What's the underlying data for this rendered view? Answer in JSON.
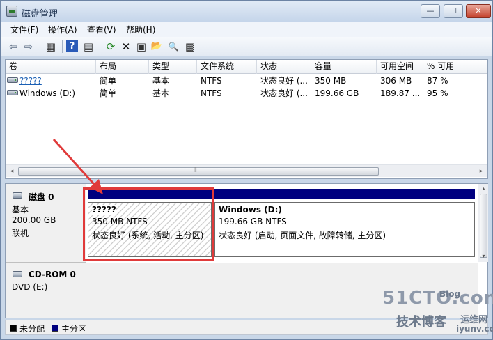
{
  "window": {
    "title": "磁盘管理",
    "min": "—",
    "max": "☐",
    "close": "✕"
  },
  "menu": [
    "文件(F)",
    "操作(A)",
    "查看(V)",
    "帮助(H)"
  ],
  "toolbar": {
    "back": "⇦",
    "forward": "⇨",
    "view": "▦",
    "help": "?",
    "panel": "▤",
    "refresh": "⟳",
    "delete": "✕",
    "properties": "▣",
    "open": "📂",
    "search": "🔍",
    "settings": "▩"
  },
  "columns": [
    "卷",
    "布局",
    "类型",
    "文件系统",
    "状态",
    "容量",
    "可用空间",
    "% 可用"
  ],
  "volumes": [
    {
      "name": "?????",
      "layout": "简单",
      "type": "基本",
      "fs": "NTFS",
      "status": "状态良好 (...",
      "capacity": "350 MB",
      "free": "306 MB",
      "pct": "87 %"
    },
    {
      "name": "Windows (D:)",
      "layout": "简单",
      "type": "基本",
      "fs": "NTFS",
      "status": "状态良好 (...",
      "capacity": "199.66 GB",
      "free": "189.87 ...",
      "pct": "95 %"
    }
  ],
  "scroll": {
    "left": "◂",
    "right": "▸",
    "up": "▴",
    "down": "▾"
  },
  "disk0": {
    "name": "磁盘 0",
    "type": "基本",
    "size": "200.00 GB",
    "state": "联机",
    "partitions": [
      {
        "name": "?????",
        "size": "350 MB NTFS",
        "status": "状态良好 (系统, 活动, 主分区)"
      },
      {
        "name": "Windows  (D:)",
        "size": "199.66 GB NTFS",
        "status": "状态良好 (启动, 页面文件, 故障转储, 主分区)"
      }
    ]
  },
  "cdrom": {
    "name": "CD-ROM 0",
    "type": "DVD (E:)"
  },
  "legend": {
    "unallocated": "未分配",
    "primary": "主分区",
    "unallocated_color": "#000000",
    "primary_color": "#00007f"
  },
  "watermark": {
    "site": "51CTO.com",
    "blog": "技术博客",
    "ops": "运维网",
    "domain": "iyunv.com",
    "blog_tag": "Blog"
  }
}
